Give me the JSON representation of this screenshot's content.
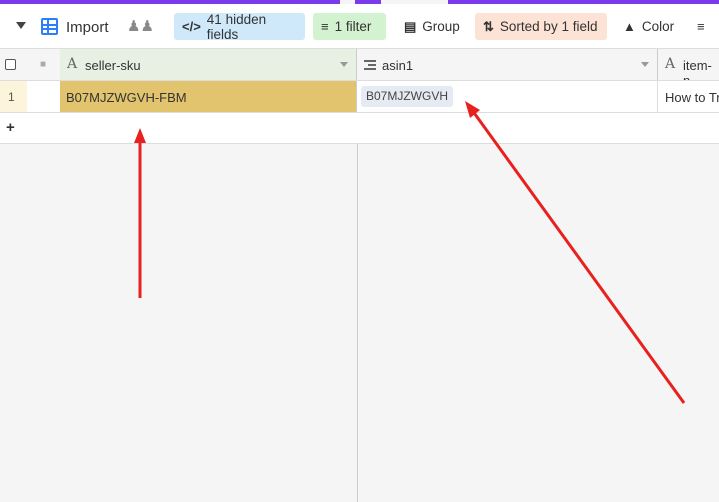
{
  "toolbar": {
    "view_name": "Import",
    "hidden_fields_label": "41 hidden fields",
    "filter_label": "1 filter",
    "group_label": "Group",
    "sort_label": "Sorted by 1 field",
    "color_label": "Color"
  },
  "columns": [
    {
      "name": "seller-sku",
      "icon": "text-type-icon"
    },
    {
      "name": "asin1",
      "icon": "linked-record-icon"
    },
    {
      "name": "item-n",
      "icon": "text-type-icon"
    }
  ],
  "rows": [
    {
      "number": "1",
      "seller_sku": "B07MJZWGVH-FBM",
      "asin1": "B07MJZWGVH",
      "item_name": "How to Tr"
    }
  ],
  "colors": {
    "accent": "#7c3aed",
    "highlight": "#e2c46e",
    "arrow": "#e8201e"
  }
}
